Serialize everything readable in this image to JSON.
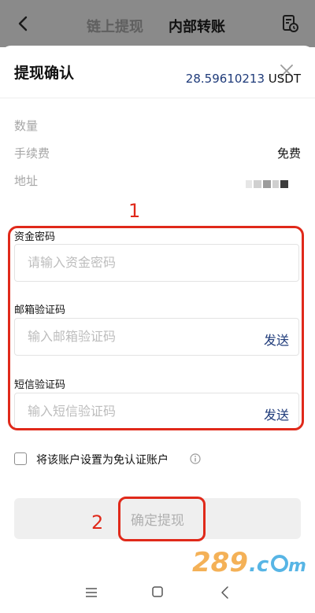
{
  "header": {
    "tab_onchain": "链上提现",
    "tab_internal": "内部转账",
    "back_icon": "chevron-left-icon",
    "history_icon": "document-clock-icon"
  },
  "sheet": {
    "title": "提现确认",
    "close_icon": "close-icon",
    "rows": {
      "amount_label": "数量",
      "amount_value": "28.59610213",
      "amount_unit": "USDT",
      "fee_label": "手续费",
      "fee_value": "免费",
      "address_label": "地址"
    },
    "fields": {
      "fund_password_label": "资金密码",
      "fund_password_placeholder": "请输入资金密码",
      "email_code_label": "邮箱验证码",
      "email_code_placeholder": "输入邮箱验证码",
      "sms_code_label": "短信验证码",
      "sms_code_placeholder": "输入短信验证码",
      "send_label": "发送"
    },
    "checkbox_label": "将该账户设置为免认证账户",
    "confirm_label": "确定提现"
  },
  "annotations": {
    "marker_1": "1",
    "marker_2": "2"
  },
  "colors": {
    "accent": "#1f3b7a",
    "annotation_red": "#e0291a"
  }
}
